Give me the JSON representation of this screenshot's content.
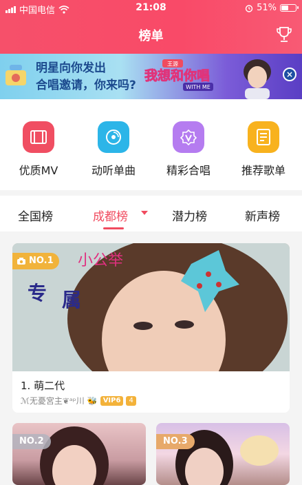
{
  "status_bar": {
    "carrier": "中国电信",
    "time": "21:08",
    "battery_text": "51%",
    "battery_level": 0.51
  },
  "header": {
    "title": "榜单",
    "trophy_icon": "trophy-icon"
  },
  "banner": {
    "line1": "明星向你发出",
    "line2": "合唱邀请，你来吗?",
    "logo_text": "我想和你唱",
    "logo_badge": "王源",
    "logo_sub": "WITH ME",
    "close_icon": "close-icon"
  },
  "categories": [
    {
      "label": "优质MV",
      "icon": "film-icon",
      "color": "#f04e62"
    },
    {
      "label": "动听单曲",
      "icon": "disc-icon",
      "color": "#2cb5e8"
    },
    {
      "label": "精彩合唱",
      "icon": "chorus-icon",
      "color": "#b57cf0"
    },
    {
      "label": "推荐歌单",
      "icon": "playlist-icon",
      "color": "#f8b21e"
    }
  ],
  "tabs": [
    {
      "label": "全国榜",
      "active": false
    },
    {
      "label": "成都榜",
      "active": true
    },
    {
      "label": "潜力榜",
      "active": false
    },
    {
      "label": "新声榜",
      "active": false
    }
  ],
  "accent": "#f04b5f",
  "featured": {
    "rank": "NO.1",
    "photo_text_1": "专",
    "photo_text_2": "属",
    "photo_text_3": "小公举",
    "title": "1. 萌二代",
    "author": "ℳ无憂宮主❦ᵃᵖ川",
    "vip": "VIP6",
    "level": "4"
  },
  "cards": [
    {
      "rank": "NO.2"
    },
    {
      "rank": "NO.3"
    }
  ]
}
